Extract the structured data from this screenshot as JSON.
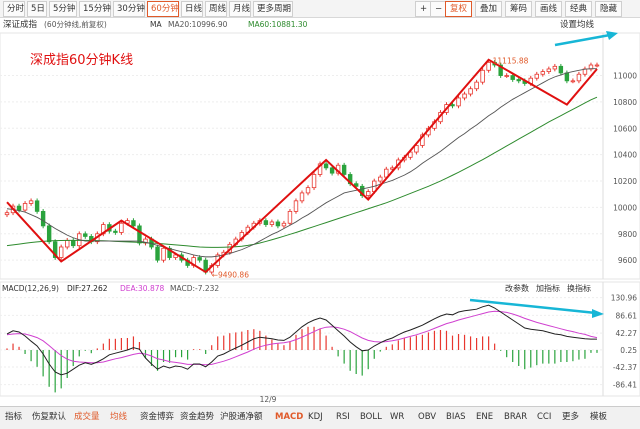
{
  "toolbar": {
    "tabs": [
      "分时",
      "5日",
      "5分钟",
      "15分钟",
      "30分钟",
      "60分钟",
      "日线",
      "周线",
      "月线",
      "更多周期"
    ],
    "active_tab": "60分钟",
    "right_buttons": [
      "+",
      "−",
      "复权",
      "叠加",
      "筹码",
      "画线",
      "经典",
      "隐藏"
    ],
    "active_right": "复权"
  },
  "info": {
    "name": "深证成指",
    "period": "(60分钟线,前复权)",
    "ma_label": "MA",
    "ma20": "MA20:10996.90",
    "ma60": "MA60:10881.30",
    "settings": "设置均线"
  },
  "annotation": {
    "title": "深成指60分钟K线"
  },
  "macd_info": {
    "name": "MACD(12,26,9)",
    "dif": "DIF:27.262",
    "dea": "DEA:30.878",
    "macd": "MACD:-7.232",
    "buttons": [
      "改参数",
      "加指标",
      "换指标"
    ]
  },
  "x_axis": {
    "label": "12/9"
  },
  "bottom_tabs": [
    "指标",
    "伤复默认",
    "成交量",
    "均线",
    "资金博弈",
    "资金趋势",
    "沪股通净额",
    "MACD",
    "KDJ",
    "RSI",
    "BOLL",
    "WR",
    "OBV",
    "BIAS",
    "ENE",
    "BRAR",
    "CCI",
    "更多",
    "模板"
  ],
  "bottom_active": "MACD",
  "colors": {
    "up": "#e8372f",
    "down": "#2aa33d",
    "ma_dark": "#555555",
    "ma_green": "#2e8b2e",
    "trend_line": "#e01010",
    "cyan_arrow": "#17b6d6",
    "dif_line": "#222222",
    "dea_line": "#d040d0",
    "accent": "#e05a2a"
  },
  "chart_data": [
    {
      "type": "candlestick",
      "title": "",
      "ylim": [
        9480,
        11300
      ],
      "y_ticks": [
        9600,
        9800,
        10000,
        10200,
        10400,
        10600,
        10800,
        11000
      ],
      "y_tick_labels": [
        "9600",
        "9800",
        "10000",
        "10200",
        "10400",
        "10600",
        "10800",
        "11000"
      ],
      "close": [
        9960,
        10010,
        9980,
        10030,
        10050,
        9970,
        9860,
        9740,
        9620,
        9700,
        9750,
        9710,
        9800,
        9780,
        9740,
        9800,
        9870,
        9820,
        9810,
        9880,
        9900,
        9860,
        9730,
        9760,
        9700,
        9600,
        9690,
        9620,
        9640,
        9600,
        9560,
        9620,
        9600,
        9510,
        9560,
        9640,
        9660,
        9720,
        9760,
        9810,
        9850,
        9880,
        9900,
        9870,
        9890,
        9860,
        9880,
        9970,
        10050,
        10110,
        10150,
        10250,
        10330,
        10300,
        10260,
        10320,
        10250,
        10180,
        10160,
        10090,
        10120,
        10200,
        10230,
        10290,
        10300,
        10360,
        10380,
        10420,
        10470,
        10550,
        10600,
        10650,
        10720,
        10780,
        10770,
        10830,
        10860,
        10900,
        10950,
        11040,
        11100,
        11080,
        11000,
        11000,
        10970,
        10960,
        10940,
        10980,
        11010,
        11030,
        11050,
        11070,
        11020,
        10960,
        10960,
        11010,
        11050,
        11080,
        11080
      ],
      "ma20": [
        9990,
        9985,
        9975,
        9965,
        9945,
        9925,
        9900,
        9870,
        9840,
        9815,
        9790,
        9770,
        9755,
        9745,
        9745,
        9745,
        9745,
        9745,
        9745,
        9745,
        9745,
        9745,
        9745,
        9735,
        9725,
        9712,
        9700,
        9688,
        9676,
        9664,
        9652,
        9640,
        9630,
        9625,
        9625,
        9630,
        9640,
        9650,
        9665,
        9680,
        9700,
        9720,
        9745,
        9770,
        9795,
        9815,
        9840,
        9865,
        9890,
        9920,
        9945,
        9975,
        10005,
        10035,
        10060,
        10085,
        10110,
        10120,
        10130,
        10140,
        10150,
        10160,
        10175,
        10190,
        10205,
        10225,
        10245,
        10270,
        10300,
        10335,
        10365,
        10395,
        10425,
        10460,
        10495,
        10530,
        10560,
        10595,
        10625,
        10660,
        10695,
        10725,
        10760,
        10790,
        10820,
        10845,
        10870,
        10895,
        10920,
        10945,
        10970,
        10990,
        11005,
        11020,
        11030,
        11040,
        11048,
        11052,
        11052
      ],
      "ma60": [
        9710,
        9716,
        9722,
        9728,
        9734,
        9739,
        9743,
        9746,
        9748,
        9749,
        9750,
        9750,
        9750,
        9750,
        9749,
        9748,
        9747,
        9745,
        9743,
        9741,
        9739,
        9737,
        9735,
        9732,
        9730,
        9727,
        9724,
        9720,
        9716,
        9712,
        9708,
        9704,
        9700,
        9698,
        9697,
        9697,
        9698,
        9700,
        9702,
        9706,
        9712,
        9720,
        9730,
        9742,
        9755,
        9768,
        9782,
        9796,
        9810,
        9825,
        9840,
        9855,
        9870,
        9885,
        9900,
        9915,
        9930,
        9945,
        9960,
        9975,
        9990,
        10005,
        10020,
        10035,
        10052,
        10070,
        10088,
        10106,
        10124,
        10142,
        10160,
        10180,
        10200,
        10222,
        10244,
        10266,
        10290,
        10314,
        10338,
        10362,
        10388,
        10414,
        10440,
        10466,
        10492,
        10518,
        10544,
        10570,
        10596,
        10622,
        10648,
        10672,
        10696,
        10720,
        10744,
        10768,
        10792,
        10816,
        10836
      ],
      "annotations": [
        "11115.88",
        "9490.86"
      ],
      "trend_lines": [
        [
          10040,
          9590,
          9900,
          9510,
          10360,
          10060,
          11120,
          10780,
          11050
        ]
      ]
    },
    {
      "type": "bar",
      "title": "",
      "ylim": [
        -105,
        140
      ],
      "y_ticks": [
        130.96,
        86.61,
        42.27,
        0.25,
        -42.37,
        -86.41
      ],
      "y_tick_labels": [
        "130.96",
        "86.61",
        "42.27",
        "0.25",
        "-42.37",
        "-86.41"
      ],
      "series": [
        {
          "name": "DIF",
          "values": [
            40,
            48,
            45,
            35,
            22,
            10,
            -10,
            -35,
            -55,
            -62,
            -58,
            -48,
            -38,
            -32,
            -36,
            -30,
            -22,
            -12,
            -8,
            -4,
            0,
            6,
            2,
            -20,
            -35,
            -48,
            -40,
            -45,
            -40,
            -42,
            -48,
            -35,
            -35,
            -42,
            -30,
            -15,
            -10,
            -2,
            5,
            12,
            20,
            28,
            32,
            30,
            28,
            25,
            24,
            32,
            45,
            58,
            68,
            75,
            80,
            75,
            62,
            48,
            35,
            20,
            8,
            -2,
            0,
            10,
            18,
            25,
            30,
            38,
            45,
            50,
            56,
            62,
            70,
            78,
            85,
            90,
            88,
            95,
            98,
            100,
            102,
            108,
            112,
            105,
            95,
            85,
            75,
            65,
            55,
            52,
            50,
            48,
            44,
            40,
            38,
            34,
            32,
            30,
            28,
            27.3,
            27.3
          ]
        },
        {
          "name": "DEA",
          "values": [
            38,
            40,
            41,
            40,
            36,
            31,
            23,
            11,
            -2,
            -14,
            -23,
            -28,
            -30,
            -31,
            -32,
            -32,
            -30,
            -26,
            -22,
            -19,
            -15,
            -11,
            -8,
            -10,
            -15,
            -22,
            -25,
            -29,
            -31,
            -33,
            -36,
            -36,
            -36,
            -37,
            -36,
            -32,
            -28,
            -23,
            -17,
            -11,
            -5,
            2,
            8,
            12,
            15,
            17,
            18,
            21,
            26,
            32,
            39,
            46,
            53,
            57,
            58,
            56,
            52,
            46,
            38,
            30,
            24,
            21,
            20,
            21,
            23,
            26,
            30,
            34,
            38,
            43,
            48,
            54,
            60,
            66,
            70,
            75,
            79,
            83,
            87,
            91,
            95,
            97,
            96,
            94,
            90,
            85,
            79,
            74,
            69,
            65,
            61,
            57,
            53,
            49,
            46,
            42,
            39,
            34,
            30.9
          ]
        },
        {
          "name": "MACD",
          "values": [
            4,
            16,
            8,
            -10,
            -28,
            -42,
            -66,
            -92,
            -106,
            -96,
            -70,
            -40,
            -16,
            -2,
            -8,
            4,
            16,
            28,
            28,
            30,
            30,
            34,
            20,
            -20,
            -40,
            -52,
            -30,
            -32,
            -18,
            -18,
            -24,
            2,
            2,
            -10,
            12,
            34,
            36,
            42,
            44,
            46,
            50,
            52,
            48,
            36,
            26,
            16,
            12,
            22,
            38,
            52,
            58,
            58,
            54,
            36,
            8,
            -16,
            -34,
            -52,
            -60,
            -64,
            -48,
            -22,
            -4,
            8,
            14,
            24,
            30,
            32,
            36,
            38,
            44,
            48,
            50,
            48,
            36,
            40,
            38,
            34,
            30,
            34,
            34,
            16,
            -2,
            -18,
            -30,
            -40,
            -48,
            -44,
            -38,
            -34,
            -34,
            -34,
            -30,
            -30,
            -28,
            -24,
            -22,
            -7.2,
            -7.2
          ]
        }
      ]
    }
  ]
}
